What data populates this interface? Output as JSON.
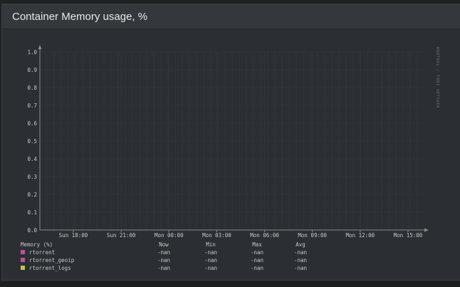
{
  "panel": {
    "title": "Container Memory usage, %"
  },
  "watermark": "RRDTOOL / TOBI OETIKER",
  "legend": {
    "header_label": "Memory (%)",
    "columns": [
      "Now",
      "Min",
      "Max",
      "Avg"
    ],
    "items": [
      {
        "name": "rtorrent",
        "color": "#c0509a",
        "now": "-nan",
        "min": "-nan",
        "max": "-nan",
        "avg": "-nan"
      },
      {
        "name": "rtorrent_geoip",
        "color": "#c0509a",
        "now": "-nan",
        "min": "-nan",
        "max": "-nan",
        "avg": "-nan"
      },
      {
        "name": "rtorrent_logs",
        "color": "#b5c84a",
        "now": "-nan",
        "min": "-nan",
        "max": "-nan",
        "avg": "-nan"
      }
    ]
  },
  "chart_data": {
    "type": "line",
    "title": "",
    "xlabel": "",
    "ylabel": "",
    "ylim": [
      0.0,
      1.0
    ],
    "y_ticks": [
      "0.0",
      "0.1",
      "0.2",
      "0.3",
      "0.4",
      "0.5",
      "0.6",
      "0.7",
      "0.8",
      "0.9",
      "1.0"
    ],
    "x_ticks": [
      "Sun 18:00",
      "Sun 21:00",
      "Mon 00:00",
      "Mon 03:00",
      "Mon 06:00",
      "Mon 09:00",
      "Mon 12:00",
      "Mon 15:00"
    ],
    "grid": true,
    "series": [
      {
        "name": "rtorrent",
        "values": []
      },
      {
        "name": "rtorrent_geoip",
        "values": []
      },
      {
        "name": "rtorrent_logs",
        "values": []
      }
    ]
  }
}
